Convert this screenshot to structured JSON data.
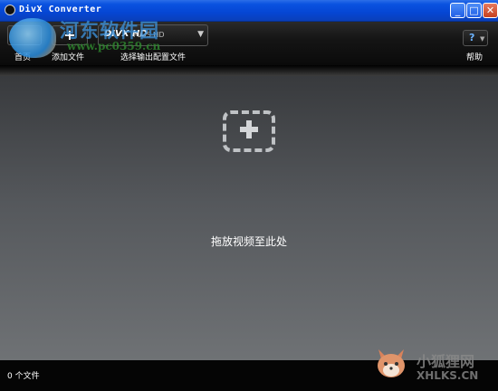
{
  "window": {
    "title": "DivX Converter"
  },
  "toolbar": {
    "home_label": "首页",
    "add_file_label": "添加文件",
    "add_icon": "+",
    "profile_brand": "DIVX HD",
    "profile_sub": "PLUS HD",
    "profile_label": "选择输出配置文件",
    "help_icon": "?",
    "help_label": "帮助"
  },
  "drop_area": {
    "text": "拖放视频至此处"
  },
  "status": {
    "file_count": "0 个文件"
  },
  "watermark": {
    "site_title": "河东软件园",
    "site_url": "www.pc0359.cn",
    "fox_title": "小狐狸网",
    "fox_url": "XHLKS.CN"
  },
  "colors": {
    "titlebar": "#0546d4",
    "toolbar_bg": "#111111",
    "drop_bg_top": "#383a3d",
    "drop_bg_bottom": "#6f7275",
    "help_accent": "#6db4ff"
  }
}
